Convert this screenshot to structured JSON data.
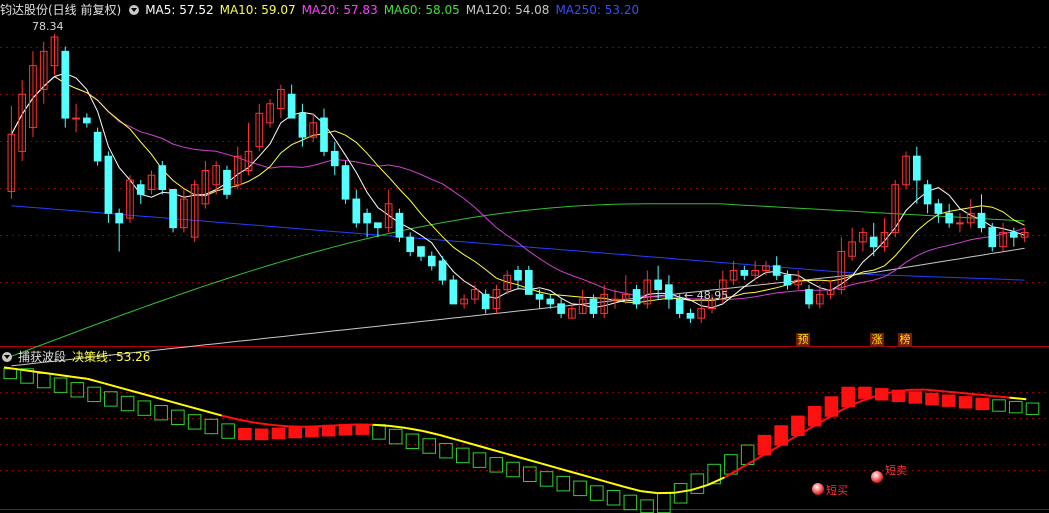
{
  "header": {
    "title": "钧达股份(日线 前复权)",
    "ma": [
      {
        "label": "MA5: 57.52",
        "color": "#ffffff"
      },
      {
        "label": "MA10: 59.07",
        "color": "#ffff00"
      },
      {
        "label": "MA20: 57.83",
        "color": "#ff40ff"
      },
      {
        "label": "MA60: 58.05",
        "color": "#40e040"
      },
      {
        "label": "MA120: 54.08",
        "color": "#c8c8c8"
      },
      {
        "label": "MA250: 53.20",
        "color": "#3050ff"
      }
    ]
  },
  "price_annotations": {
    "high": "78.34",
    "low": "48.95"
  },
  "tags": {
    "yu": "预",
    "zhang": "涨",
    "bang": "榜"
  },
  "indicator": {
    "title": "捕获波段",
    "decision_label": "决策线:",
    "decision_value": "53.26",
    "signal_buy": "短买",
    "signal_sell": "短卖"
  },
  "colors": {
    "up": "#ff3232",
    "down": "#54ffff",
    "ma5": "#ffffff",
    "ma10": "#ffff40",
    "ma20": "#d040d0",
    "ma60": "#30c030",
    "ma120": "#c8c8c8",
    "ma250": "#2040ff",
    "grid": "#8a0000",
    "ind_red": "#ff1010",
    "ind_green": "#30d030",
    "ind_yellow": "#ffff00"
  },
  "chart_data": {
    "type": "candlestick",
    "y_range": [
      46,
      80
    ],
    "candles": [
      [
        61.8,
        67.8,
        61.0,
        70.8
      ],
      [
        66.0,
        72.0,
        65.0,
        73.5
      ],
      [
        68.5,
        75.0,
        67.5,
        76.5
      ],
      [
        72.5,
        76.5,
        71.0,
        77.5
      ],
      [
        75.0,
        78.0,
        74.0,
        78.3
      ],
      [
        76.5,
        69.5,
        68.5,
        77.0
      ],
      [
        69.5,
        69.5,
        68.0,
        71.0
      ],
      [
        69.5,
        69.0,
        68.5,
        70.0
      ],
      [
        68.0,
        65.0,
        64.5,
        68.5
      ],
      [
        65.5,
        59.5,
        58.5,
        66.0
      ],
      [
        59.5,
        58.5,
        55.5,
        60.0
      ],
      [
        59.0,
        63.0,
        58.5,
        63.5
      ],
      [
        62.5,
        61.5,
        60.5,
        63.0
      ],
      [
        62.0,
        63.5,
        61.5,
        64.0
      ],
      [
        64.5,
        62.0,
        61.5,
        65.0
      ],
      [
        62.0,
        58.0,
        57.5,
        62.0
      ],
      [
        58.0,
        61.0,
        57.5,
        62.0
      ],
      [
        57.0,
        62.5,
        56.5,
        63.0
      ],
      [
        60.5,
        64.0,
        60.0,
        65.0
      ],
      [
        62.5,
        64.5,
        61.5,
        65.0
      ],
      [
        64.0,
        61.5,
        61.0,
        64.5
      ],
      [
        62.5,
        65.5,
        62.0,
        66.5
      ],
      [
        64.0,
        66.0,
        63.5,
        69.0
      ],
      [
        66.5,
        70.0,
        66.0,
        71.0
      ],
      [
        69.0,
        71.0,
        68.5,
        71.5
      ],
      [
        70.5,
        72.5,
        69.5,
        73.0
      ],
      [
        72.0,
        69.5,
        69.5,
        73.0
      ],
      [
        70.0,
        67.5,
        66.5,
        71.0
      ],
      [
        67.5,
        69.0,
        67.0,
        70.0
      ],
      [
        69.5,
        66.0,
        65.5,
        70.5
      ],
      [
        66.0,
        64.5,
        63.5,
        67.0
      ],
      [
        64.5,
        61.0,
        60.5,
        65.0
      ],
      [
        61.0,
        58.5,
        58.0,
        62.0
      ],
      [
        59.5,
        58.5,
        57.0,
        60.0
      ],
      [
        58.5,
        58.0,
        57.0,
        58.5
      ],
      [
        58.0,
        60.5,
        57.5,
        62.0
      ],
      [
        59.5,
        57.0,
        56.5,
        60.0
      ],
      [
        57.0,
        55.5,
        55.0,
        57.5
      ],
      [
        56.0,
        55.0,
        54.5,
        56.0
      ],
      [
        55.0,
        54.0,
        53.5,
        55.5
      ],
      [
        54.5,
        52.5,
        52.0,
        55.0
      ],
      [
        52.5,
        50.0,
        50.0,
        53.0
      ],
      [
        50.0,
        50.5,
        49.5,
        51.0
      ],
      [
        50.5,
        51.5,
        50.0,
        52.0
      ],
      [
        51.0,
        49.5,
        49.0,
        51.5
      ],
      [
        49.5,
        51.5,
        49.0,
        52.0
      ],
      [
        51.5,
        53.0,
        51.0,
        53.5
      ],
      [
        53.5,
        52.5,
        51.5,
        54.0
      ],
      [
        53.5,
        51.0,
        51.0,
        54.0
      ],
      [
        51.0,
        50.5,
        49.5,
        51.5
      ],
      [
        50.5,
        50.0,
        49.5,
        51.0
      ],
      [
        50.0,
        49.0,
        48.5,
        50.5
      ],
      [
        48.5,
        49.5,
        48.5,
        50.0
      ],
      [
        49.0,
        50.5,
        49.0,
        51.5
      ],
      [
        50.5,
        49.0,
        48.5,
        51.0
      ],
      [
        49.0,
        51.0,
        48.5,
        52.0
      ],
      [
        50.5,
        50.5,
        49.5,
        51.5
      ],
      [
        50.5,
        51.0,
        50.0,
        53.0
      ],
      [
        51.5,
        50.0,
        49.5,
        52.0
      ],
      [
        50.0,
        52.5,
        49.5,
        53.5
      ],
      [
        52.5,
        51.5,
        50.5,
        54.0
      ],
      [
        52.0,
        50.5,
        49.5,
        53.0
      ],
      [
        50.5,
        49.0,
        48.5,
        51.0
      ],
      [
        49.0,
        48.5,
        48.0,
        49.5
      ],
      [
        48.5,
        49.5,
        48.0,
        50.5
      ],
      [
        49.5,
        50.5,
        49.0,
        51.0
      ],
      [
        50.5,
        52.5,
        50.0,
        53.5
      ],
      [
        52.5,
        53.5,
        52.0,
        54.5
      ],
      [
        53.5,
        53.0,
        52.5,
        54.0
      ],
      [
        53.0,
        53.5,
        52.5,
        54.5
      ],
      [
        53.5,
        54.0,
        53.0,
        54.5
      ],
      [
        54.0,
        53.0,
        52.5,
        55.0
      ],
      [
        53.0,
        52.0,
        51.5,
        53.5
      ],
      [
        52.0,
        52.5,
        51.5,
        53.5
      ],
      [
        51.5,
        50.0,
        49.5,
        52.0
      ],
      [
        50.0,
        51.0,
        49.5,
        52.0
      ],
      [
        51.0,
        51.5,
        50.5,
        52.5
      ],
      [
        51.5,
        55.5,
        51.0,
        57.0
      ],
      [
        55.0,
        56.5,
        54.5,
        58.0
      ],
      [
        56.5,
        57.5,
        55.5,
        58.0
      ],
      [
        57.0,
        56.0,
        55.0,
        58.5
      ],
      [
        56.0,
        57.5,
        55.5,
        59.0
      ],
      [
        57.5,
        62.5,
        57.0,
        63.0
      ],
      [
        62.5,
        65.5,
        62.0,
        66.0
      ],
      [
        65.5,
        63.0,
        60.5,
        66.5
      ],
      [
        62.5,
        60.5,
        59.5,
        63.0
      ],
      [
        60.5,
        59.5,
        58.5,
        61.0
      ],
      [
        59.5,
        58.5,
        58.0,
        60.5
      ],
      [
        58.5,
        58.5,
        57.5,
        59.5
      ],
      [
        58.5,
        59.5,
        58.0,
        61.0
      ],
      [
        59.5,
        58.0,
        57.5,
        61.5
      ],
      [
        58.0,
        56.0,
        55.5,
        58.5
      ],
      [
        56.0,
        57.5,
        55.5,
        58.5
      ],
      [
        57.5,
        57.0,
        56.0,
        58.0
      ],
      [
        57.0,
        57.5,
        56.5,
        58.0
      ]
    ],
    "x_count": 95,
    "annotations": {
      "high": 78.34,
      "low": 48.95
    }
  }
}
